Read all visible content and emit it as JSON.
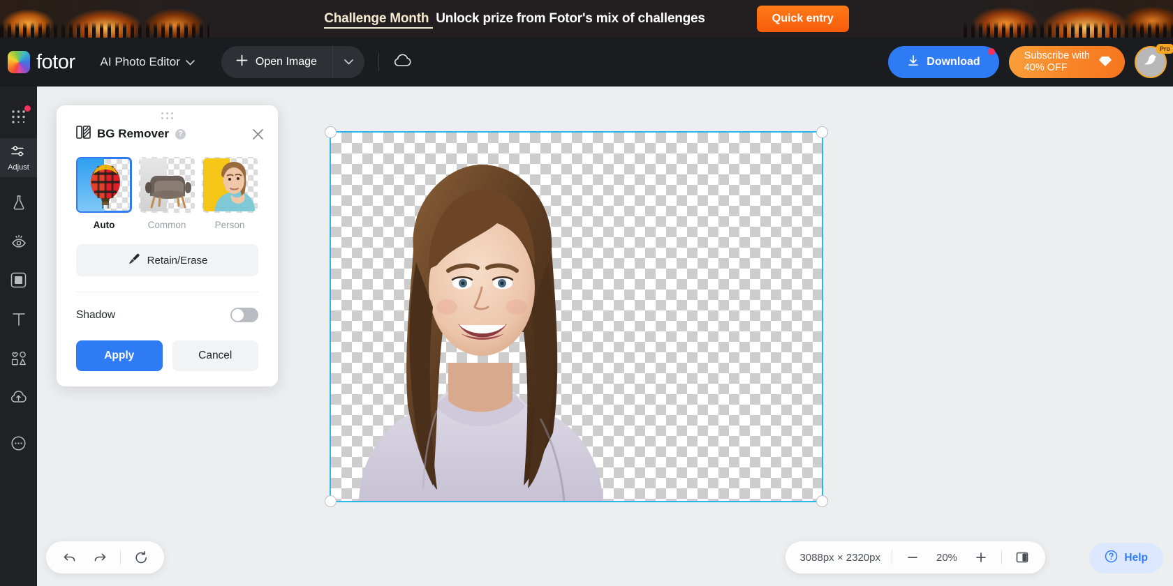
{
  "promo": {
    "highlight": "Challenge Month",
    "text": "Unlock prize from Fotor's mix of challenges",
    "cta": "Quick entry"
  },
  "header": {
    "brand": "fotor",
    "mode": "AI Photo Editor",
    "open_image": "Open Image",
    "download": "Download",
    "subscribe_line1": "Subscribe with",
    "subscribe_line2": "40% OFF",
    "pro_badge": "Pro"
  },
  "sidebar": {
    "items": [
      {
        "name": "apps",
        "label": ""
      },
      {
        "name": "adjust",
        "label": "Adjust"
      },
      {
        "name": "ai-tools",
        "label": ""
      },
      {
        "name": "retouch",
        "label": ""
      },
      {
        "name": "frame",
        "label": ""
      },
      {
        "name": "text",
        "label": ""
      },
      {
        "name": "elements",
        "label": ""
      },
      {
        "name": "upload",
        "label": ""
      },
      {
        "name": "feedback",
        "label": ""
      }
    ]
  },
  "panel": {
    "title": "BG Remover",
    "help_glyph": "?",
    "modes": [
      {
        "label": "Auto",
        "selected": true
      },
      {
        "label": "Common",
        "selected": false
      },
      {
        "label": "Person",
        "selected": false
      }
    ],
    "retain_erase": "Retain/Erase",
    "shadow_label": "Shadow",
    "shadow_on": false,
    "apply": "Apply",
    "cancel": "Cancel"
  },
  "statusbar": {
    "dimensions": "3088px × 2320px",
    "zoom": "20%",
    "zoom_out": "−",
    "zoom_in": "+",
    "help": "Help"
  },
  "colors": {
    "accent_blue": "#2f7bf6",
    "selection_cyan": "#29b6e8",
    "promo_orange": "#f8842a",
    "notification_pink": "#f5325b",
    "panel_bg": "#ffffff",
    "workspace_bg": "#eceef0",
    "header_bg": "#1b1c1f",
    "rail_bg": "#202124"
  }
}
